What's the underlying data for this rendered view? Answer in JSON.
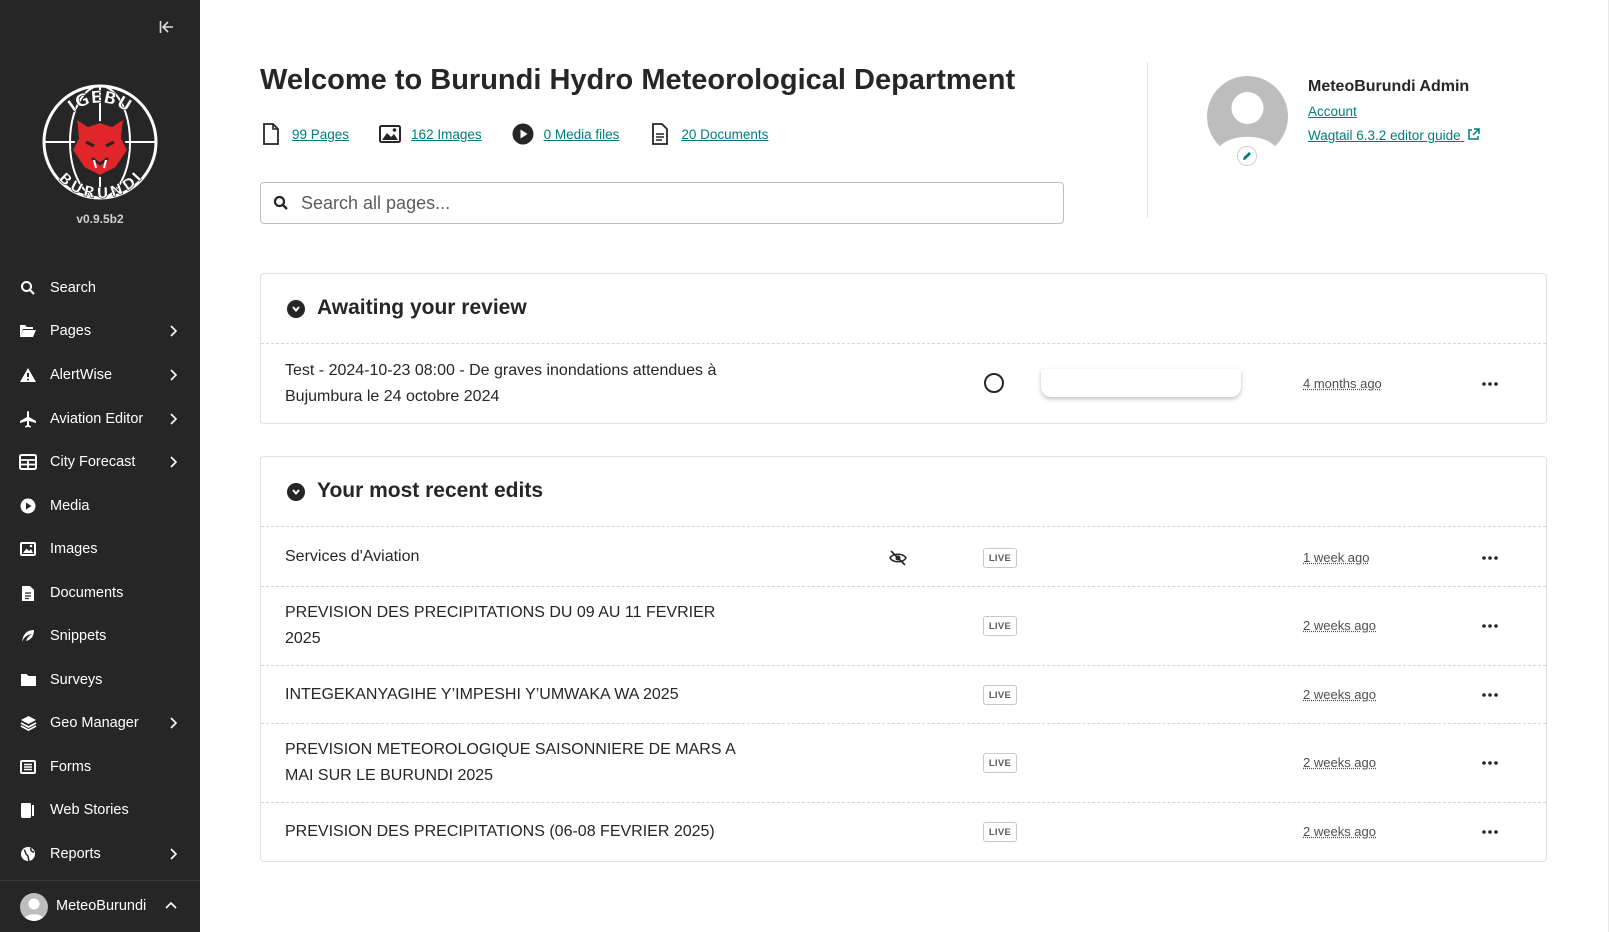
{
  "sidebar": {
    "version": "v0.9.5b2",
    "logo_text_top": "IGEBU",
    "logo_text_bottom": "BURUNDI",
    "items": [
      {
        "label": "Search",
        "icon": "search-icon"
      },
      {
        "label": "Pages",
        "icon": "folder-open-icon",
        "has_submenu": true
      },
      {
        "label": "AlertWise",
        "icon": "warning-icon",
        "has_submenu": true
      },
      {
        "label": "Aviation Editor",
        "icon": "plane-icon",
        "has_submenu": true
      },
      {
        "label": "City Forecast",
        "icon": "table-icon",
        "has_submenu": true
      },
      {
        "label": "Media",
        "icon": "play-icon"
      },
      {
        "label": "Images",
        "icon": "image-icon"
      },
      {
        "label": "Documents",
        "icon": "document-icon"
      },
      {
        "label": "Snippets",
        "icon": "snippet-icon"
      },
      {
        "label": "Surveys",
        "icon": "folder-icon"
      },
      {
        "label": "Geo Manager",
        "icon": "layers-icon",
        "has_submenu": true
      },
      {
        "label": "Forms",
        "icon": "list-icon"
      },
      {
        "label": "Web Stories",
        "icon": "stories-icon"
      },
      {
        "label": "Reports",
        "icon": "globe-icon",
        "has_submenu": true
      }
    ],
    "footer_user": "MeteoBurundi"
  },
  "header": {
    "title": "Welcome to Burundi Hydro Meteorological Department",
    "summary": [
      {
        "label": "99 Pages",
        "icon": "page-icon"
      },
      {
        "label": "162 Images",
        "icon": "image-icon"
      },
      {
        "label": "0 Media files",
        "icon": "media-icon"
      },
      {
        "label": "20 Documents",
        "icon": "document-icon"
      }
    ],
    "search_placeholder": "Search all pages..."
  },
  "user": {
    "name": "MeteoBurundi Admin",
    "account_link": "Account",
    "guide_link": "Wagtail 6.3.2 editor guide"
  },
  "review_panel": {
    "title": "Awaiting your review",
    "rows": [
      {
        "title": "Test - 2024-10-23 08:00 - De graves inondations attendues à Bujumbura le 24 octobre 2024",
        "time": "4 months ago"
      }
    ]
  },
  "edits_panel": {
    "title": "Your most recent edits",
    "rows": [
      {
        "title": "Services d'Aviation",
        "status": "LIVE",
        "time": "1 week ago",
        "private": true
      },
      {
        "title": "PREVISION DES PRECIPITATIONS DU 09 AU 11 FEVRIER 2025",
        "status": "LIVE",
        "time": "2 weeks ago"
      },
      {
        "title": "INTEGEKANYAGIHE Y’IMPESHI Y’UMWAKA WA 2025",
        "status": "LIVE",
        "time": "2 weeks ago"
      },
      {
        "title": "PREVISION METEOROLOGIQUE SAISONNIERE DE MARS A MAI SUR LE BURUNDI 2025",
        "status": "LIVE",
        "time": "2 weeks ago"
      },
      {
        "title": "PREVISION DES PRECIPITATIONS (06-08 FEVRIER 2025)",
        "status": "LIVE",
        "time": "2 weeks ago"
      }
    ]
  },
  "colors": {
    "sidebar_bg": "#262626",
    "link": "#007d7e",
    "logo_red": "#e0262a"
  }
}
